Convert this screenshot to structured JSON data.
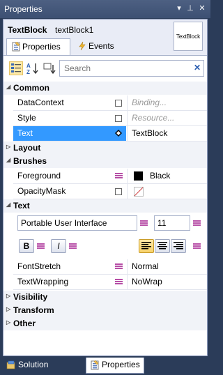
{
  "window": {
    "title": "Properties"
  },
  "header": {
    "type_name": "TextBlock",
    "object_name": "textBlock1",
    "preview_text": "TextBlock"
  },
  "tabs": [
    {
      "label": "Properties"
    },
    {
      "label": "Events"
    }
  ],
  "search": {
    "placeholder": "Search",
    "value": ""
  },
  "categories": {
    "common": "Common",
    "layout": "Layout",
    "brushes": "Brushes",
    "text": "Text",
    "visibility": "Visibility",
    "transform": "Transform",
    "other": "Other"
  },
  "common_props": [
    {
      "name": "DataContext",
      "value": "Binding..."
    },
    {
      "name": "Style",
      "value": "Resource..."
    },
    {
      "name": "Text",
      "value": "TextBlock"
    }
  ],
  "brush_props": [
    {
      "name": "Foreground",
      "value": "Black",
      "swatch": "#000000"
    },
    {
      "name": "OpacityMask",
      "value": ""
    }
  ],
  "text_props": {
    "font_family": "Portable User Interface",
    "font_size": "11",
    "bold_label": "B",
    "italic_label": "I",
    "font_stretch_label": "FontStretch",
    "font_stretch_value": "Normal",
    "text_wrapping_label": "TextWrapping",
    "text_wrapping_value": "NoWrap"
  },
  "bottom_tabs": [
    {
      "label": "Solution Explorer"
    },
    {
      "label": "Properties"
    }
  ],
  "colors": {
    "selected_row": "#3399ff",
    "title_bar": "#3d5073",
    "resource_marker": "#b74fa7"
  }
}
